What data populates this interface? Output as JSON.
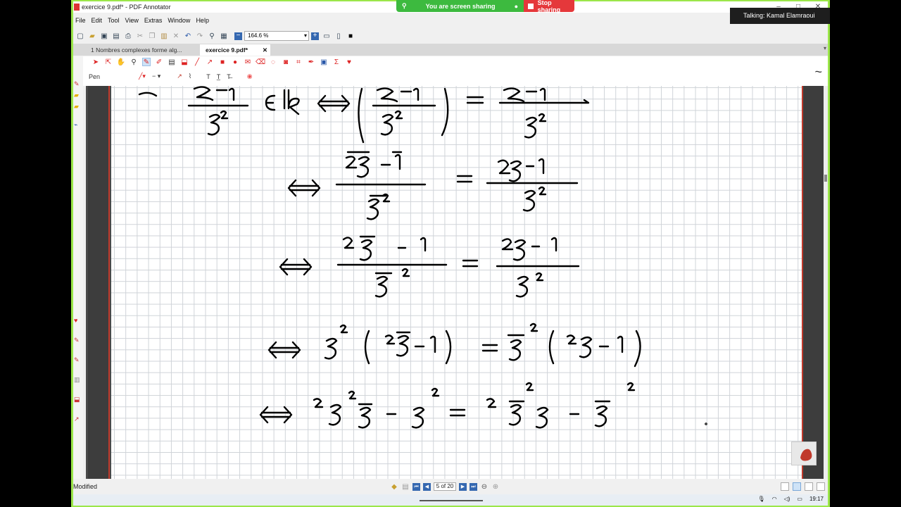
{
  "window": {
    "title": "exercice 9.pdf* - PDF Annotator"
  },
  "screenshare": {
    "sharing_label": "You are screen sharing",
    "stop_label": "Stop sharing"
  },
  "talking": {
    "label": "Talking: Kamal Elamraoui"
  },
  "menu": [
    "File",
    "Edit",
    "Tool",
    "View",
    "Extras",
    "Window",
    "Help"
  ],
  "zoom": {
    "value": "164.6 %"
  },
  "tabs": [
    {
      "label": "1 Nombres complexes forme alg...",
      "active": false
    },
    {
      "label": "exercice 9.pdf*",
      "active": true,
      "close": "✕"
    }
  ],
  "tool": {
    "active_name": "Pen"
  },
  "colors": {
    "accent": "#3568b0",
    "pen": "#d22222",
    "page_border": "#c0392b",
    "frame_green": "#9be64a"
  },
  "status": {
    "text": "Modified"
  },
  "pager": {
    "current_page": "5 of 20"
  },
  "clock": {
    "time": "19:17"
  },
  "ink": {
    "line1_mid": "∈ℝ"
  }
}
